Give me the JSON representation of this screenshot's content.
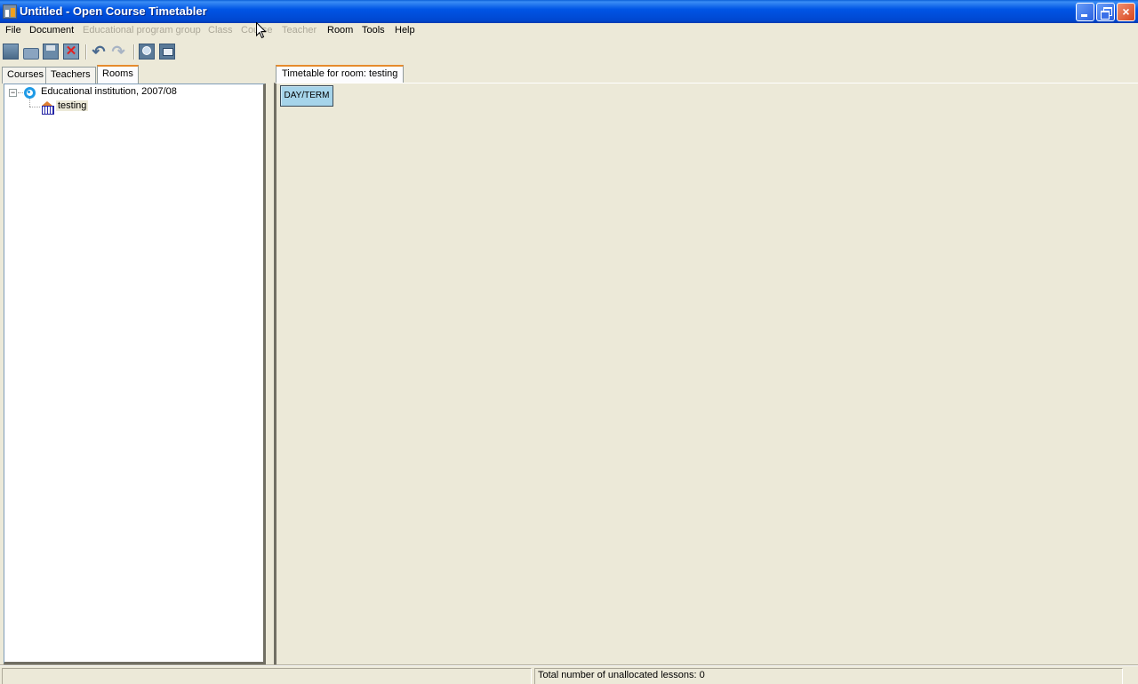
{
  "window": {
    "title": "Untitled - Open Course Timetabler",
    "controls": {
      "minimize": "minimize",
      "maximize": "restore",
      "close": "×"
    }
  },
  "menubar": {
    "items": [
      {
        "label": "File",
        "enabled": true
      },
      {
        "label": "Document",
        "enabled": true
      },
      {
        "label": "Educational program group",
        "enabled": false
      },
      {
        "label": "Class",
        "enabled": false
      },
      {
        "label": "Course",
        "enabled": false
      },
      {
        "label": "Teacher",
        "enabled": false
      },
      {
        "label": "Room",
        "enabled": true
      },
      {
        "label": "Tools",
        "enabled": true
      },
      {
        "label": "Help",
        "enabled": true
      }
    ]
  },
  "toolbar": {
    "buttons": [
      {
        "icon": "new-document-icon",
        "glyph": ""
      },
      {
        "icon": "open-folder-icon",
        "glyph": ""
      },
      {
        "icon": "save-disk-icon",
        "glyph": ""
      },
      {
        "icon": "close-document-icon",
        "glyph": "✕"
      },
      {
        "icon": "undo-arrow-icon",
        "glyph": "↶"
      },
      {
        "icon": "redo-arrow-icon",
        "glyph": "↷"
      },
      {
        "icon": "find-magnifier-icon",
        "glyph": ""
      },
      {
        "icon": "view-monitor-icon",
        "glyph": ""
      }
    ]
  },
  "left_panel": {
    "tabs": [
      {
        "label": "Courses",
        "active": false
      },
      {
        "label": "Teachers",
        "active": false
      },
      {
        "label": "Rooms",
        "active": true
      }
    ],
    "tree": {
      "root": {
        "label": "Educational institution, 2007/08",
        "expanded": true,
        "expander": "−"
      },
      "children": [
        {
          "label": "testing",
          "selected": true
        }
      ]
    }
  },
  "right_panel": {
    "tab_label": "Timetable for room: testing",
    "header_cell": "DAY/TERM"
  },
  "statusbar": {
    "left_text": "",
    "right_text": "Total number of unallocated lessons: 0"
  }
}
